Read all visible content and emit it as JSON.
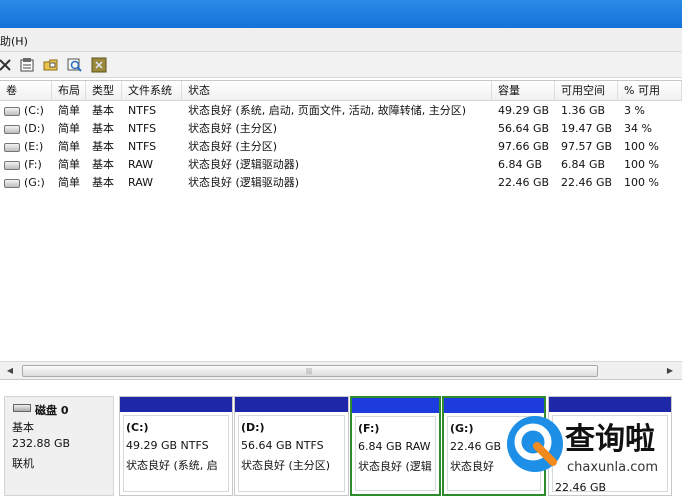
{
  "menubar": {
    "help_label": "助(H)"
  },
  "toolbar": {
    "icons": [
      "close-icon",
      "properties-icon",
      "open-folder-icon",
      "find-icon",
      "help-icon"
    ]
  },
  "volume_list": {
    "columns": [
      "卷",
      "布局",
      "类型",
      "文件系统",
      "状态",
      "容量",
      "可用空间",
      "% 可用"
    ],
    "rows": [
      {
        "volume": "(C:)",
        "layout": "简单",
        "type": "基本",
        "fs": "NTFS",
        "status": "状态良好 (系统, 启动, 页面文件, 活动, 故障转储, 主分区)",
        "capacity": "49.29 GB",
        "free": "1.36 GB",
        "pct": "3 %"
      },
      {
        "volume": "(D:)",
        "layout": "简单",
        "type": "基本",
        "fs": "NTFS",
        "status": "状态良好 (主分区)",
        "capacity": "56.64 GB",
        "free": "19.47 GB",
        "pct": "34 %"
      },
      {
        "volume": "(E:)",
        "layout": "简单",
        "type": "基本",
        "fs": "NTFS",
        "status": "状态良好 (主分区)",
        "capacity": "97.66 GB",
        "free": "97.57 GB",
        "pct": "100 %"
      },
      {
        "volume": "(F:)",
        "layout": "简单",
        "type": "基本",
        "fs": "RAW",
        "status": "状态良好 (逻辑驱动器)",
        "capacity": "6.84 GB",
        "free": "6.84 GB",
        "pct": "100 %"
      },
      {
        "volume": "(G:)",
        "layout": "简单",
        "type": "基本",
        "fs": "RAW",
        "status": "状态良好 (逻辑驱动器)",
        "capacity": "22.46 GB",
        "free": "22.46 GB",
        "pct": "100 %"
      }
    ]
  },
  "disk": {
    "name": "磁盘 0",
    "type": "基本",
    "size": "232.88 GB",
    "state": "联机",
    "partitions": [
      {
        "label": "(C:)",
        "size_fs": "49.29 GB NTFS",
        "status": "状态良好 (系统, 启"
      },
      {
        "label": "(D:)",
        "size_fs": "56.64 GB NTFS",
        "status": "状态良好 (主分区)"
      },
      {
        "label": "(F:)",
        "size_fs": "6.84 GB RAW",
        "status": "状态良好 (逻辑"
      },
      {
        "label": "(G:)",
        "size_fs": "22.46 GB",
        "status": "状态良好"
      },
      {
        "label": "",
        "size_fs": "22.46 GB",
        "status": ""
      }
    ]
  },
  "watermark": {
    "brand": "查询啦",
    "site": "chaxunla.com"
  },
  "colors": {
    "primary_partition": "#1d27a8",
    "logical_partition": "#1c3cde",
    "selection": "#2e8b2e",
    "titlebar": "#1572d8"
  }
}
